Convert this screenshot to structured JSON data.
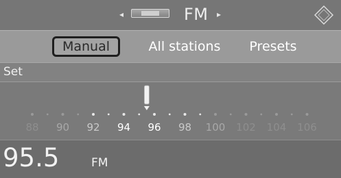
{
  "header": {
    "band": "FM",
    "left_arrow_icon": "arrow-left-icon",
    "right_arrow_icon": "arrow-right-icon",
    "source_icon": "radio-source-icon",
    "options_icon": "options-icon"
  },
  "tabs": [
    {
      "label": "Manual",
      "selected": true
    },
    {
      "label": "All stations",
      "selected": false
    },
    {
      "label": "Presets",
      "selected": false
    }
  ],
  "set_label": "Set",
  "scale": {
    "labels": [
      "88",
      "90",
      "92",
      "94",
      "96",
      "98",
      "100",
      "102",
      "104",
      "106"
    ],
    "current": 95.5,
    "min": 87.5,
    "max": 107.5
  },
  "frequency": {
    "value": "95.5",
    "unit": "FM"
  }
}
